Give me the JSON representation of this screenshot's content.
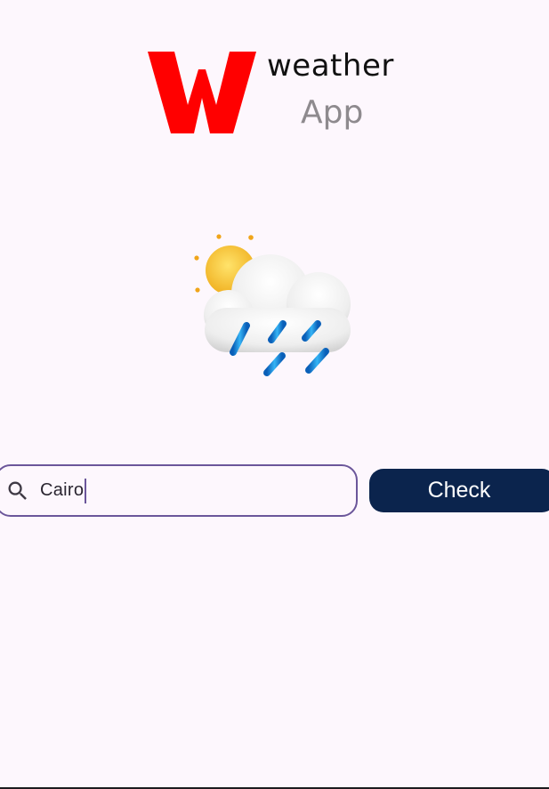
{
  "logo": {
    "mark": "W",
    "word": "weather",
    "sub": "App",
    "mark_color": "#ff0000"
  },
  "weather_icon": "sun-cloud-rain-icon",
  "search": {
    "icon": "search-icon",
    "value": "Cairo"
  },
  "check_button": {
    "label": "Check",
    "color": "#0b244d"
  }
}
